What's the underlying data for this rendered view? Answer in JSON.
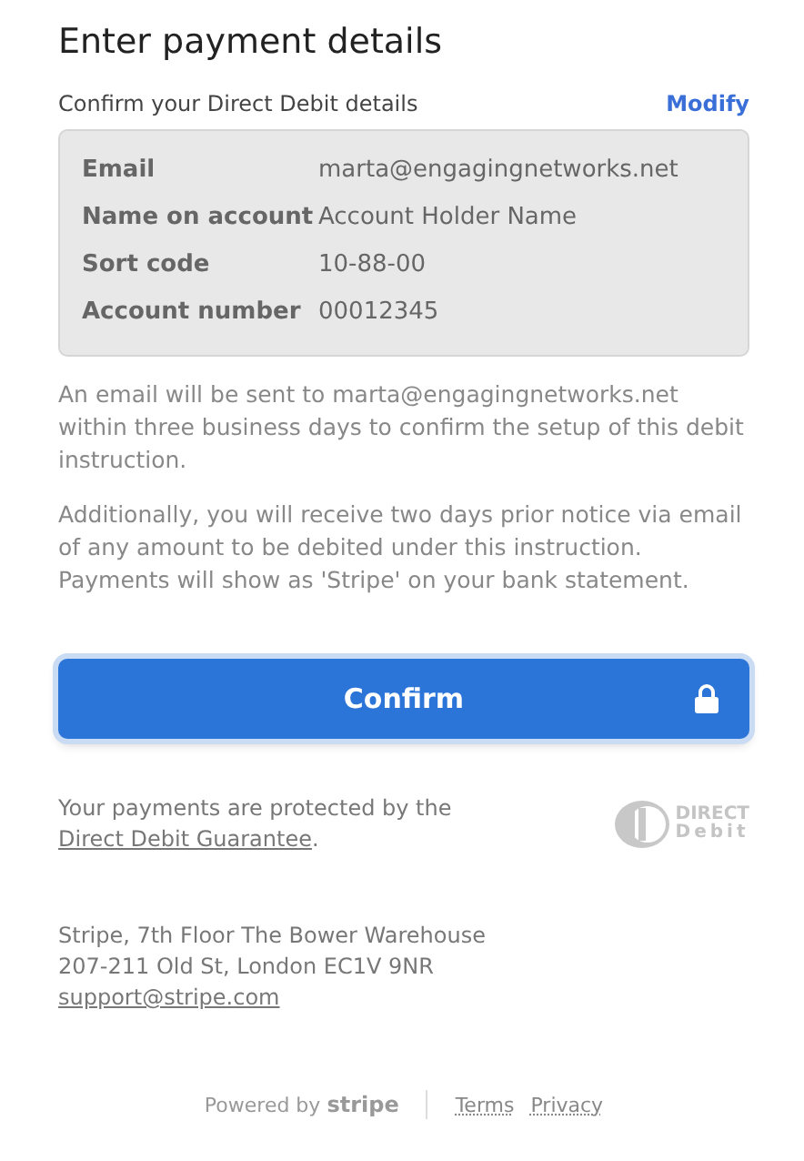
{
  "title": "Enter payment details",
  "section": {
    "heading": "Confirm your Direct Debit details",
    "action": "Modify"
  },
  "details": [
    {
      "label": "Email",
      "value": "marta@engagingnetworks.net"
    },
    {
      "label": "Name on account",
      "value": "Account Holder Name"
    },
    {
      "label": "Sort code",
      "value": "10-88-00"
    },
    {
      "label": "Account number",
      "value": "00012345"
    }
  ],
  "notices": [
    "An email will be sent to marta@engagingnetworks.net within three business days to confirm the setup of this debit instruction.",
    "Additionally, you will receive two days prior notice via email of any amount to be debited under this instruction. Payments will show as 'Stripe' on your bank statement."
  ],
  "confirm_button": "Confirm",
  "guarantee": {
    "before": "Your payments are protected by the",
    "link": "Direct Debit Guarantee",
    "after": "."
  },
  "direct_debit_logo": {
    "line1": "DIRECT",
    "line2": "Debit"
  },
  "address": [
    "Stripe, 7th Floor The Bower Warehouse",
    "207-211 Old St, London EC1V 9NR"
  ],
  "support_email": "support@stripe.com",
  "footer": {
    "powered_by": "Powered by",
    "brand": "stripe",
    "links": [
      "Terms",
      "Privacy"
    ]
  }
}
